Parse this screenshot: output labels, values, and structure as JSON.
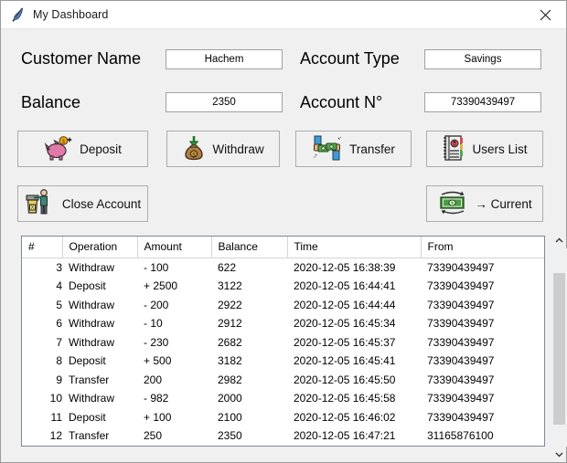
{
  "window": {
    "title": "My Dashboard",
    "app_icon": "feather-icon",
    "close_label": "✕"
  },
  "form": {
    "customer_name": {
      "label": "Customer Name",
      "value": "Hachem",
      "placeholder": ""
    },
    "account_type": {
      "label": "Account Type",
      "value": "Savings",
      "placeholder": ""
    },
    "balance": {
      "label": "Balance",
      "value": "2350",
      "placeholder": ""
    },
    "account_no": {
      "label": "Account N°",
      "value": "73390439497",
      "placeholder": ""
    }
  },
  "actions": [
    {
      "id": "deposit",
      "label": "Deposit",
      "icon": "piggy-bank-icon"
    },
    {
      "id": "withdraw",
      "label": "Withdraw",
      "icon": "money-bag-icon"
    },
    {
      "id": "transfer",
      "label": "Transfer",
      "icon": "money-exchange-hands-icon"
    },
    {
      "id": "users-list",
      "label": "Users List",
      "icon": "address-book-icon"
    },
    {
      "id": "close-account",
      "label": "Close Account",
      "icon": "delete-account-icon"
    },
    {
      "id": "to-current",
      "label": "→ Current",
      "icon": "banknote-refresh-icon"
    }
  ],
  "table": {
    "columns": [
      "#",
      "Operation",
      "Amount",
      "Balance",
      "Time",
      "From"
    ],
    "rows": [
      {
        "n": "3",
        "operation": "Withdraw",
        "amount": "- 100",
        "balance": "622",
        "time": "2020-12-05 16:38:39",
        "from": "73390439497"
      },
      {
        "n": "4",
        "operation": "Deposit",
        "amount": "+ 2500",
        "balance": "3122",
        "time": "2020-12-05 16:44:41",
        "from": "73390439497"
      },
      {
        "n": "5",
        "operation": "Withdraw",
        "amount": "- 200",
        "balance": "2922",
        "time": "2020-12-05 16:44:44",
        "from": "73390439497"
      },
      {
        "n": "6",
        "operation": "Withdraw",
        "amount": "- 10",
        "balance": "2912",
        "time": "2020-12-05 16:45:34",
        "from": "73390439497"
      },
      {
        "n": "7",
        "operation": "Withdraw",
        "amount": "- 230",
        "balance": "2682",
        "time": "2020-12-05 16:45:37",
        "from": "73390439497"
      },
      {
        "n": "8",
        "operation": "Deposit",
        "amount": "+ 500",
        "balance": "3182",
        "time": "2020-12-05 16:45:41",
        "from": "73390439497"
      },
      {
        "n": "9",
        "operation": "Transfer",
        "amount": "200",
        "balance": "2982",
        "time": "2020-12-05 16:45:50",
        "from": "73390439497"
      },
      {
        "n": "10",
        "operation": "Withdraw",
        "amount": "- 982",
        "balance": "2000",
        "time": "2020-12-05 16:45:58",
        "from": "73390439497"
      },
      {
        "n": "11",
        "operation": "Deposit",
        "amount": "+ 100",
        "balance": "2100",
        "time": "2020-12-05 16:46:02",
        "from": "73390439497"
      },
      {
        "n": "12",
        "operation": "Transfer",
        "amount": "250",
        "balance": "2350",
        "time": "2020-12-05 16:47:21",
        "from": "31165876100"
      }
    ]
  },
  "scrollbar": {
    "up": "⌃",
    "down": "⌄"
  },
  "colors": {
    "window_bg": "#f0f0f0",
    "titlebar_bg": "#ffffff",
    "field_bg": "#ffffff",
    "border": "#a0a0a0",
    "text": "#000000"
  }
}
